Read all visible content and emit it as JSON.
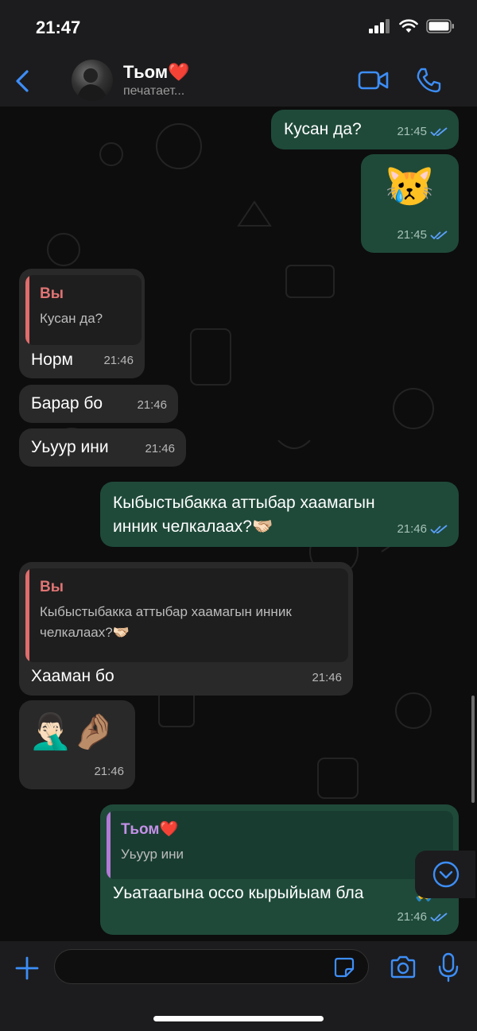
{
  "status_bar": {
    "time": "21:47"
  },
  "header": {
    "contact_name": "Тьом",
    "contact_heart": "❤️",
    "contact_status": "печатает..."
  },
  "messages": [
    {
      "dir": "out",
      "text": "Кусан да?",
      "time": "21:45"
    },
    {
      "dir": "out",
      "emoji": "😿",
      "time": "21:45"
    },
    {
      "dir": "in",
      "reply_author": "Вы",
      "reply_text": "Кусан да?",
      "text": "Норм",
      "time": "21:46"
    },
    {
      "dir": "in",
      "text": "Барар бо",
      "time": "21:46"
    },
    {
      "dir": "in",
      "text": "Уьуур ини",
      "time": "21:46"
    },
    {
      "dir": "out",
      "text_line1": "Кыбыстыбакка аттыбар хаамагын",
      "text_line2": "инник челкалаах?🫱🏻‍🫲🏼",
      "time": "21:46"
    },
    {
      "dir": "in",
      "reply_author": "Вы",
      "reply_line1": "Кыбыстыбакка аттыбар хаамагын инник",
      "reply_line2": "челкалаах?🫱🏻‍🫲🏼",
      "text": "Хааман бо",
      "time": "21:46"
    },
    {
      "dir": "in",
      "emoji": "🤦🏻‍♂️🤌🏽",
      "time": "21:46"
    },
    {
      "dir": "out",
      "reply_author": "Тьом❤️",
      "reply_text": "Уьуур ини",
      "text": "Уьатаагына оссо кырыйыам бла",
      "trailing_emoji": "🙏",
      "time": "21:46"
    }
  ],
  "input": {
    "placeholder": ""
  },
  "colors": {
    "accent": "#3d8ef7",
    "outgoing_bubble": "#1f4a3a",
    "incoming_bubble": "#292929",
    "read_ticks": "#5aa0ff"
  }
}
